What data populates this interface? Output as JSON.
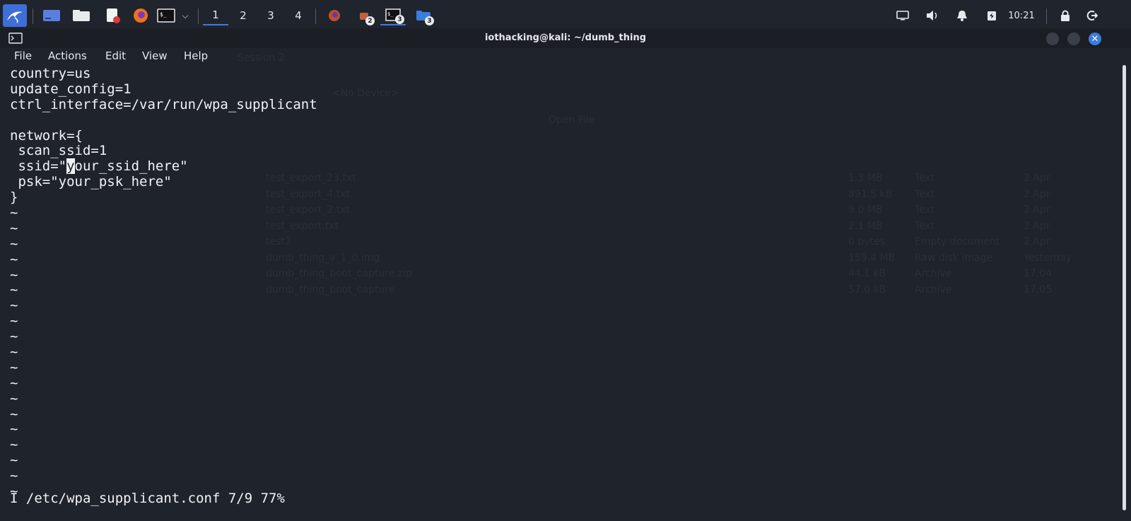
{
  "panel": {
    "workspaces": [
      "1",
      "2",
      "3",
      "4"
    ],
    "active_workspace": "1",
    "badges": {
      "app1": "2",
      "app2": "3",
      "app3": "3"
    },
    "clock": "10:21"
  },
  "window": {
    "title": "iothacking@kali: ~/dumb_thing"
  },
  "menu": [
    "File",
    "Actions",
    "Edit",
    "View",
    "Help"
  ],
  "editor": {
    "lines": [
      "country=us",
      "update_config=1",
      "ctrl_interface=/var/run/wpa_supplicant",
      "",
      "network={",
      " scan_ssid=1",
      " ssid=\"your_ssid_here\"",
      " psk=\"your_psk_here\"",
      "}",
      "~",
      "~",
      "~",
      "~",
      "~",
      "~",
      "~",
      "~",
      "~",
      "~",
      "~",
      "~",
      "~",
      "~",
      "~",
      "~",
      "~",
      "~",
      "~"
    ],
    "cursor": {
      "line": 6,
      "col": 7
    },
    "status": "I /etc/wpa_supplicant.conf 7/9 77%"
  },
  "ghost_app": {
    "tab": "Session 2",
    "device": "<No Device>",
    "open_file": "Open File",
    "files": [
      {
        "name": "test_export_23.txt",
        "size": "1.3 MB",
        "type": "Text",
        "date": "2 Apr"
      },
      {
        "name": "test_export_4.txt",
        "size": "891.5 kB",
        "type": "Text",
        "date": "2 Apr"
      },
      {
        "name": "test_export_2.txt",
        "size": "9.0 MB",
        "type": "Text",
        "date": "2 Apr"
      },
      {
        "name": "test_export.txt",
        "size": "2.1 MB",
        "type": "Text",
        "date": "2 Apr"
      },
      {
        "name": "test2",
        "size": "0 bytes",
        "type": "Empty document",
        "date": "2 Apr"
      },
      {
        "name": "dumb_thing_v_1_0.img",
        "size": "159.4 MB",
        "type": "Raw disk image",
        "date": "Yesterday"
      },
      {
        "name": "dumb_thing_boot_capture.zip",
        "size": "44.1 kB",
        "type": "Archive",
        "date": "17:04"
      },
      {
        "name": "dumb_thing_boot_capture",
        "size": "57.0 kB",
        "type": "Archive",
        "date": "17:05"
      }
    ]
  }
}
